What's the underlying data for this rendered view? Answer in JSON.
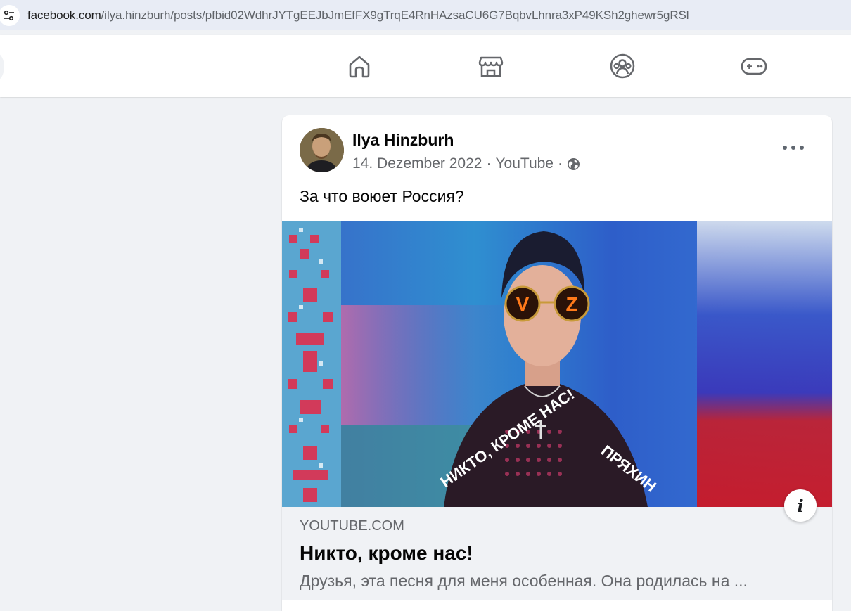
{
  "browser": {
    "url_host": "facebook.com",
    "url_path": "/ilya.hinzburh/posts/pfbid02WdhrJYTgEEJbJmEfFX9gTrqE4RnHAzsaCU6G7BqbvLhnra3xP49KSh2ghewr5gRSl",
    "site_info_icon": "tune-icon"
  },
  "nav": {
    "tabs": [
      {
        "name": "home",
        "icon": "home-icon"
      },
      {
        "name": "marketplace",
        "icon": "marketplace-icon"
      },
      {
        "name": "groups",
        "icon": "groups-icon"
      },
      {
        "name": "gaming",
        "icon": "gaming-icon"
      }
    ]
  },
  "post": {
    "author": "Ilya Hinzburh",
    "date": "14. Dezember 2022",
    "source": "YouTube",
    "separator": "·",
    "audience_icon": "globe-icon",
    "text": "За что воюет Россия?",
    "more_icon": "more-options-icon",
    "thumbnail_texts": {
      "left_jacket": "НИКТО, КРОМЕ НАС!",
      "right_jacket": "ПРЯХИН",
      "glasses": "V Z"
    },
    "info_button": "i",
    "link": {
      "domain": "YOUTUBE.COM",
      "title": "Никто, кроме нас!",
      "description": "Друзья, эта песня для меня особенная. Она родилась на ..."
    }
  },
  "colors": {
    "accent_blue": "#0866ff",
    "text_primary": "#050505",
    "text_secondary": "#65676b",
    "background": "#f0f2f5"
  }
}
